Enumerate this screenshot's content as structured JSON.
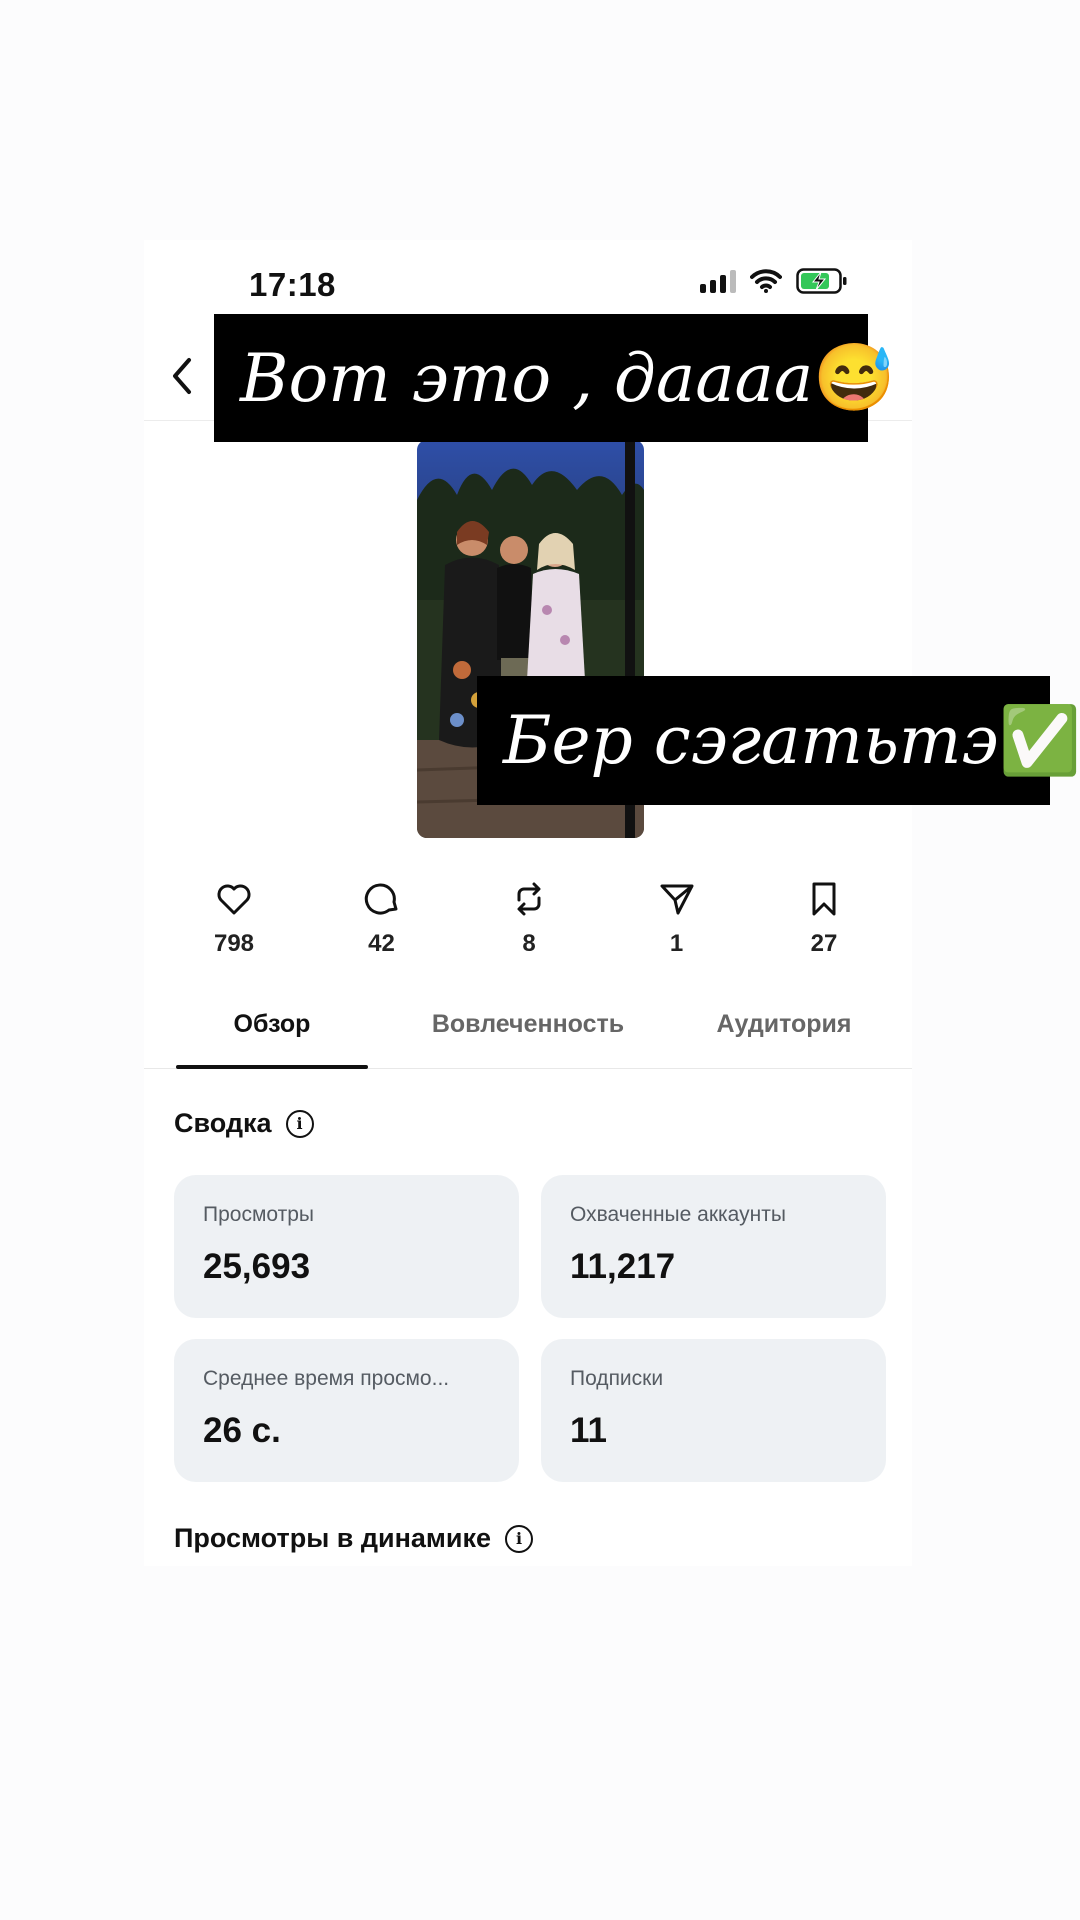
{
  "status_bar": {
    "time": "17:18"
  },
  "nav": {
    "right_glyph": "+"
  },
  "post": {
    "stats": [
      {
        "icon": "heart-icon",
        "count": "798"
      },
      {
        "icon": "comment-icon",
        "count": "42"
      },
      {
        "icon": "repost-icon",
        "count": "8"
      },
      {
        "icon": "share-icon",
        "count": "1"
      },
      {
        "icon": "bookmark-icon",
        "count": "27"
      }
    ]
  },
  "tabs": [
    "Обзор",
    "Вовлеченность",
    "Аудитория"
  ],
  "summary": {
    "title": "Сводка",
    "cards": [
      {
        "label": "Просмотры",
        "value": "25,693"
      },
      {
        "label": "Охваченные аккаунты",
        "value": "11,217"
      },
      {
        "label": "Среднее время просмо...",
        "value": "26 с."
      },
      {
        "label": "Подписки",
        "value": "11"
      }
    ]
  },
  "views_dynamics": {
    "title": "Просмотры в динамике"
  },
  "story_captions": [
    {
      "text": "Вот это , даааа",
      "emoji": "😅"
    },
    {
      "text": "Бер сэгатьтэ",
      "emoji": "✅"
    }
  ],
  "colors": {
    "card_bg": "#eef1f4",
    "caption_bg": "#000000",
    "tab_active": "#111111",
    "battery_green": "#34c759"
  }
}
